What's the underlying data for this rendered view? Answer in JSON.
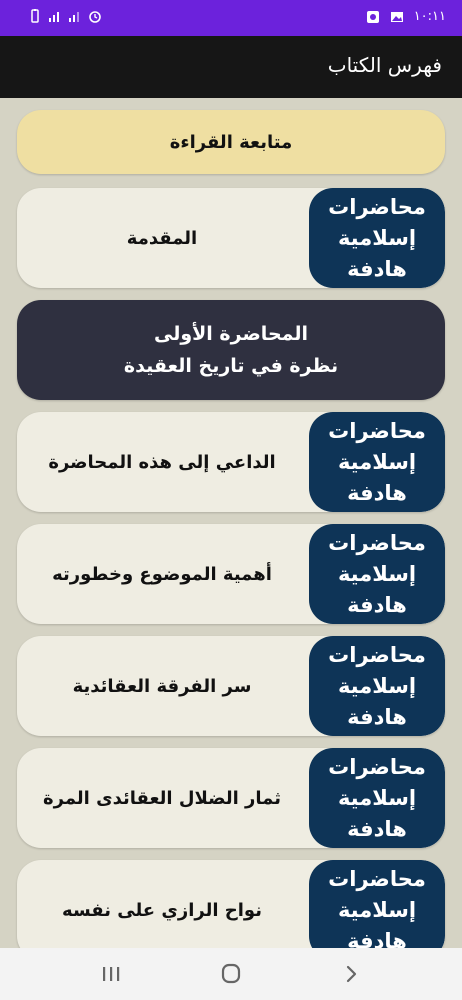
{
  "status_bar": {
    "time": "١٠:١١"
  },
  "app_bar": {
    "title": "فهرس الكتاب"
  },
  "follow_reading": {
    "label": "متابعة القراءة"
  },
  "logo": {
    "line1": "محاضرات",
    "line2": "إسلامية",
    "line3": "هادفة"
  },
  "lecture_header": {
    "line1": "المحاضرة الأولى",
    "line2": "نظرة في تاريخ العقيدة"
  },
  "items": [
    {
      "label": "المقدمة"
    },
    {
      "label": "الداعي إلى هذه المحاضرة"
    },
    {
      "label": "أهمية الموضوع وخطورته"
    },
    {
      "label": "سر الفرقة العقائدية"
    },
    {
      "label": "ثمار الضلال العقائدى المرة"
    },
    {
      "label": "نواح الرازي على نفسه"
    }
  ],
  "colors": {
    "status_bar": "#6c22dc",
    "app_bar": "#161616",
    "background": "#d5d3c4",
    "card": "#efede2",
    "follow_card": "#efdfa2",
    "header_card": "#2f3040",
    "logo": "#0e3457"
  }
}
